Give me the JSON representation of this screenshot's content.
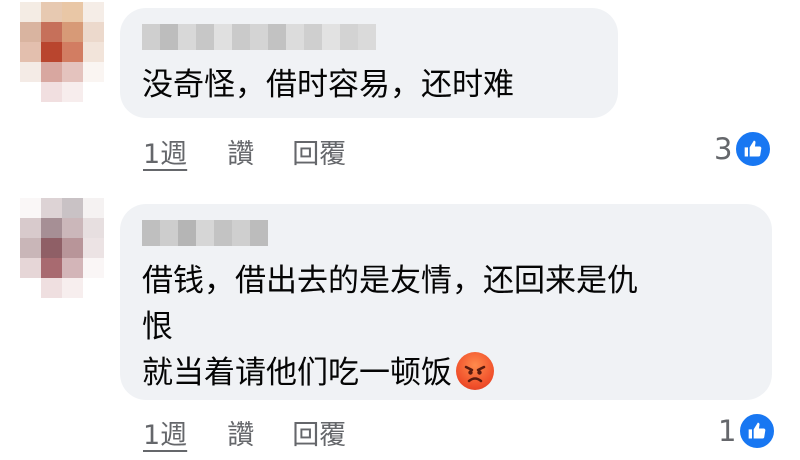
{
  "comments": [
    {
      "text_lines": [
        "没奇怪，借时容易，还时难"
      ],
      "actions": {
        "time": "1週",
        "like": "讚",
        "reply": "回覆"
      },
      "reaction_count": "3",
      "reaction_icon": "thumbs-up-icon"
    },
    {
      "text_lines": [
        "借钱，借出去的是友情，还回来是仇",
        "恨",
        "就当着请他们吃一顿饭"
      ],
      "emoji_icon": "angry-face-icon",
      "actions": {
        "time": "1週",
        "like": "讚",
        "reply": "回覆"
      },
      "reaction_count": "1",
      "reaction_icon": "thumbs-up-icon"
    }
  ],
  "colors": {
    "bubble": "#f0f2f5",
    "secondary_text": "#65676b",
    "like_blue": "#1877f2"
  }
}
